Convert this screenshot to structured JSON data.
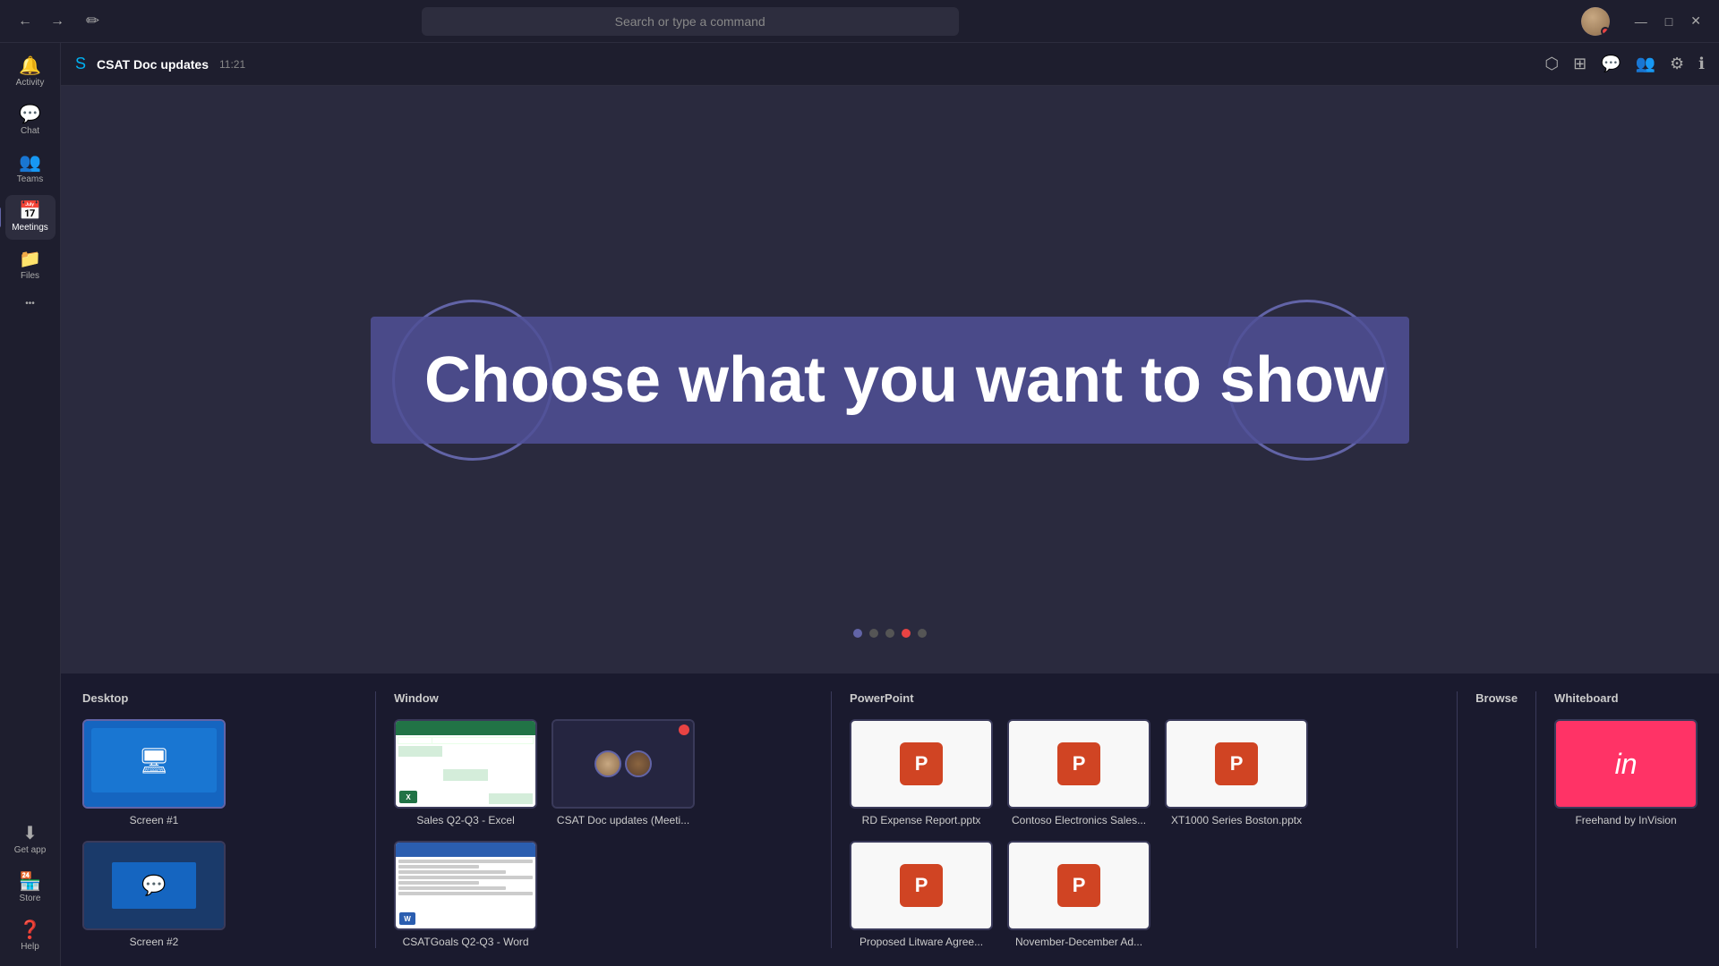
{
  "titlebar": {
    "back_label": "←",
    "forward_label": "→",
    "compose_icon": "✏",
    "search_placeholder": "Search or type a command",
    "minimize_label": "—",
    "maximize_label": "□",
    "close_label": "✕"
  },
  "sidebar": {
    "items": [
      {
        "id": "activity",
        "label": "Activity",
        "icon": "🔔"
      },
      {
        "id": "chat",
        "label": "Chat",
        "icon": "💬"
      },
      {
        "id": "teams",
        "label": "Teams",
        "icon": "👥"
      },
      {
        "id": "meetings",
        "label": "Meetings",
        "icon": "📅",
        "active": true
      },
      {
        "id": "files",
        "label": "Files",
        "icon": "📁"
      }
    ],
    "bottom_items": [
      {
        "id": "get-app",
        "label": "Get app",
        "icon": "⬇"
      },
      {
        "id": "store",
        "label": "Store",
        "icon": "🏪"
      },
      {
        "id": "help",
        "label": "Help",
        "icon": "❓"
      }
    ],
    "more_label": "•••"
  },
  "meeting": {
    "title": "CSAT Doc updates",
    "time": "11:21",
    "header_actions": [
      {
        "id": "share-screen",
        "icon": "⬡"
      },
      {
        "id": "whiteboard",
        "icon": "⊞"
      },
      {
        "id": "chat",
        "icon": "💬"
      },
      {
        "id": "participants",
        "icon": "👥"
      },
      {
        "id": "settings",
        "icon": "⚙"
      },
      {
        "id": "info",
        "icon": "ℹ"
      }
    ]
  },
  "overlay": {
    "text": "Choose what you want to show"
  },
  "share": {
    "sections": [
      {
        "id": "desktop",
        "label": "Desktop",
        "items": [
          {
            "id": "screen1",
            "label": "Screen #1",
            "type": "desktop"
          },
          {
            "id": "screen2",
            "label": "Screen #2",
            "type": "desktop2"
          }
        ]
      },
      {
        "id": "window",
        "label": "Window",
        "items": [
          {
            "id": "excel",
            "label": "Sales Q2-Q3 - Excel",
            "type": "excel"
          },
          {
            "id": "teams-meeting",
            "label": "CSAT Doc updates (Meeti...",
            "type": "teams-meeting"
          },
          {
            "id": "csatgoals",
            "label": "CSATGoals Q2-Q3 - Word",
            "type": "word"
          }
        ]
      },
      {
        "id": "powerpoint",
        "label": "PowerPoint",
        "items": [
          {
            "id": "ppt1",
            "label": "RD Expense Report.pptx",
            "type": "ppt"
          },
          {
            "id": "ppt2",
            "label": "Contoso Electronics Sales...",
            "type": "ppt"
          },
          {
            "id": "ppt3",
            "label": "XT1000 Series Boston.pptx",
            "type": "ppt"
          },
          {
            "id": "ppt4",
            "label": "Proposed Litware Agree...",
            "type": "ppt"
          },
          {
            "id": "ppt5",
            "label": "November-December Ad...",
            "type": "ppt"
          }
        ]
      },
      {
        "id": "browse",
        "label": "Browse",
        "items": []
      },
      {
        "id": "whiteboard",
        "label": "Whiteboard",
        "items": [
          {
            "id": "invision",
            "label": "Freehand by InVision",
            "type": "invision"
          }
        ]
      }
    ]
  }
}
